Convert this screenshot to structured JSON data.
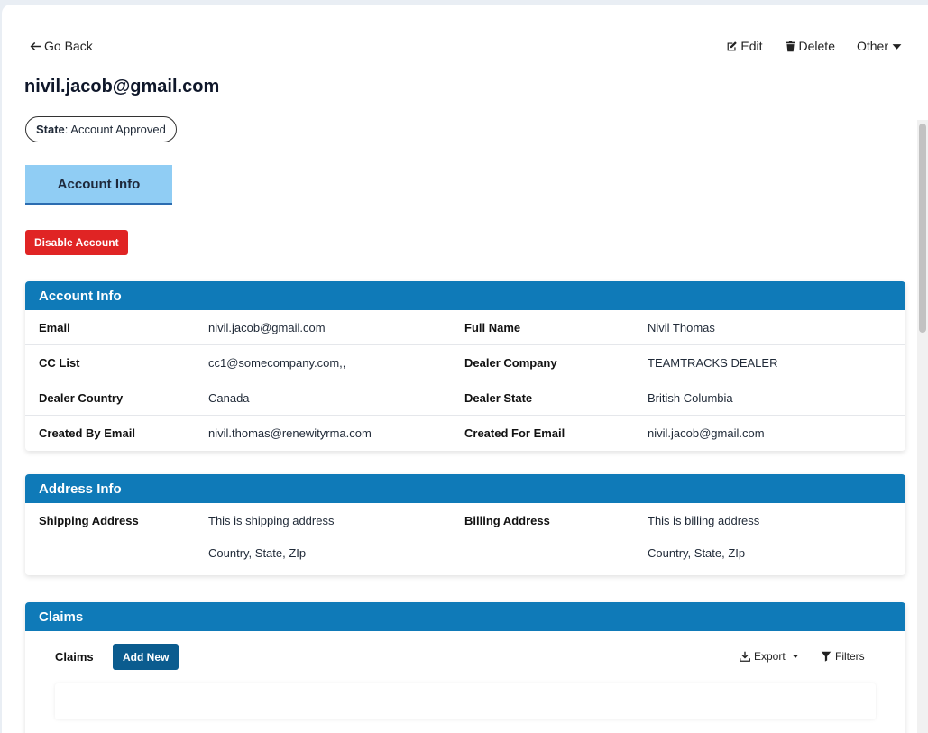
{
  "header": {
    "go_back": "Go Back",
    "edit": "Edit",
    "delete": "Delete",
    "other": "Other"
  },
  "page_title": "nivil.jacob@gmail.com",
  "state": {
    "label": "State",
    "value": ": Account Approved"
  },
  "tabs": [
    {
      "label": "Account Info",
      "active": true
    }
  ],
  "disable_button": "Disable Account",
  "account_info": {
    "title": "Account Info",
    "rows": [
      {
        "l1": "Email",
        "v1": "nivil.jacob@gmail.com",
        "l2": "Full Name",
        "v2": "Nivil Thomas"
      },
      {
        "l1": "CC List",
        "v1": "cc1@somecompany.com,,",
        "l2": "Dealer Company",
        "v2": "TEAMTRACKS DEALER"
      },
      {
        "l1": "Dealer Country",
        "v1": "Canada",
        "l2": "Dealer State",
        "v2": "British Columbia"
      },
      {
        "l1": "Created By Email",
        "v1": "nivil.thomas@renewityrma.com",
        "l2": "Created For Email",
        "v2": "nivil.jacob@gmail.com"
      }
    ]
  },
  "address_info": {
    "title": "Address Info",
    "shipping_label": "Shipping Address",
    "shipping_line1": "This is shipping address",
    "shipping_line2": "Country, State, ZIp",
    "billing_label": "Billing Address",
    "billing_line1": "This is billing address",
    "billing_line2": "Country, State, ZIp"
  },
  "claims": {
    "title": "Claims",
    "label": "Claims",
    "add_new": "Add New",
    "export": "Export",
    "filters": "Filters"
  },
  "colors": {
    "header_blue": "#0f7ab8",
    "tab_active": "#90cdf4",
    "danger": "#e02424",
    "primary_button": "#0b5c8f"
  }
}
